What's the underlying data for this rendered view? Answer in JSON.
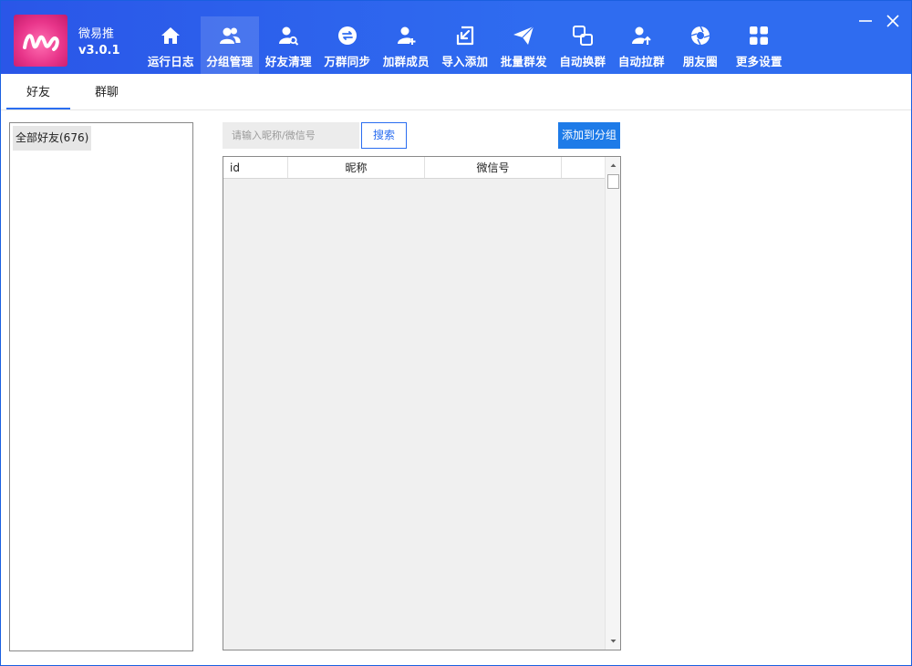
{
  "app": {
    "name": "微易推",
    "version": "v3.0.1"
  },
  "nav": [
    {
      "label": "运行日志",
      "icon": "home-icon"
    },
    {
      "label": "分组管理",
      "icon": "users-icon",
      "active": true
    },
    {
      "label": "好友清理",
      "icon": "user-search-icon"
    },
    {
      "label": "万群同步",
      "icon": "sync-icon"
    },
    {
      "label": "加群成员",
      "icon": "user-add-icon"
    },
    {
      "label": "导入添加",
      "icon": "import-icon"
    },
    {
      "label": "批量群发",
      "icon": "send-icon"
    },
    {
      "label": "自动换群",
      "icon": "switch-icon"
    },
    {
      "label": "自动拉群",
      "icon": "user-up-icon"
    },
    {
      "label": "朋友圈",
      "icon": "camera-icon"
    },
    {
      "label": "更多设置",
      "icon": "grid-icon"
    }
  ],
  "tabs": [
    {
      "label": "好友",
      "active": true
    },
    {
      "label": "群聊"
    }
  ],
  "groups": [
    {
      "label": "全部好友(676)"
    }
  ],
  "search": {
    "placeholder": "请输入昵称/微信号",
    "button": "搜索"
  },
  "add_button": "添加到分组",
  "table": {
    "columns": [
      "id",
      "昵称",
      "微信号"
    ],
    "rows": []
  },
  "colors": {
    "header": "#2f6cf0",
    "accent": "#1e7be8",
    "logo": "#e8358a"
  }
}
